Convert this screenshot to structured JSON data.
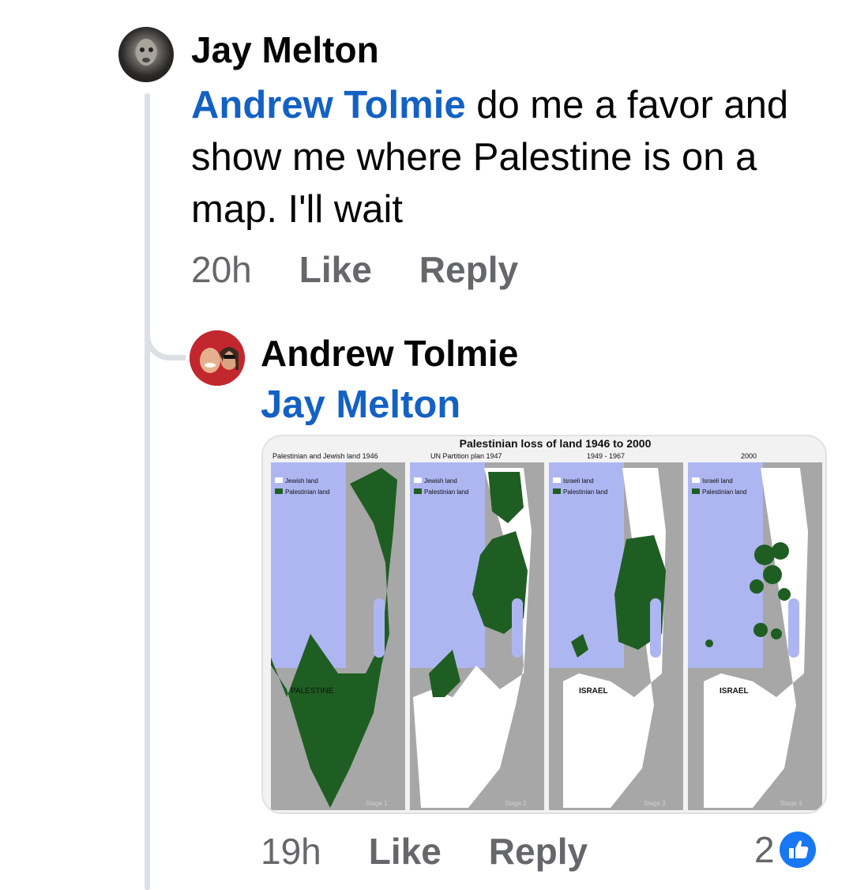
{
  "comment": {
    "author": "Jay Melton",
    "mention": "Andrew Tolmie",
    "text": " do me a favor and show me where Palestine is on a map. I'll wait",
    "time": "20h",
    "like_label": "Like",
    "reply_label": "Reply"
  },
  "reply": {
    "author": "Andrew Tolmie",
    "mention": "Jay Melton",
    "time": "19h",
    "like_label": "Like",
    "reply_label": "Reply",
    "reaction_count": "2",
    "reaction_icon": "like-icon",
    "image": {
      "title": "Palestinian loss of land 1946 to 2000",
      "panels": [
        {
          "caption": "Palestinian and Jewish land 1946",
          "legend_light": "Jewish land",
          "legend_dark": "Palestinian land",
          "label": "PALESTINE",
          "stage": "Stage 1"
        },
        {
          "caption": "UN Partition plan  1947",
          "legend_light": "Jewish land",
          "legend_dark": "Palestinian land",
          "label": "",
          "stage": "Stage 2"
        },
        {
          "caption": "1949 - 1967",
          "legend_light": "Israeli land",
          "legend_dark": "Palestinian land",
          "label": "ISRAEL",
          "stage": "Stage 3"
        },
        {
          "caption": "2000",
          "legend_light": "Israeli land",
          "legend_dark": "Palestinian land",
          "label": "ISRAEL",
          "stage": "Stage 4"
        }
      ]
    }
  },
  "colors": {
    "link": "#1461c4",
    "meta": "#65676b",
    "thread": "#dcdfe4",
    "map_green": "#1f5e22",
    "map_sea": "#aeb6f2",
    "map_land": "#a7a7a7",
    "like_blue": "#1877f2"
  }
}
